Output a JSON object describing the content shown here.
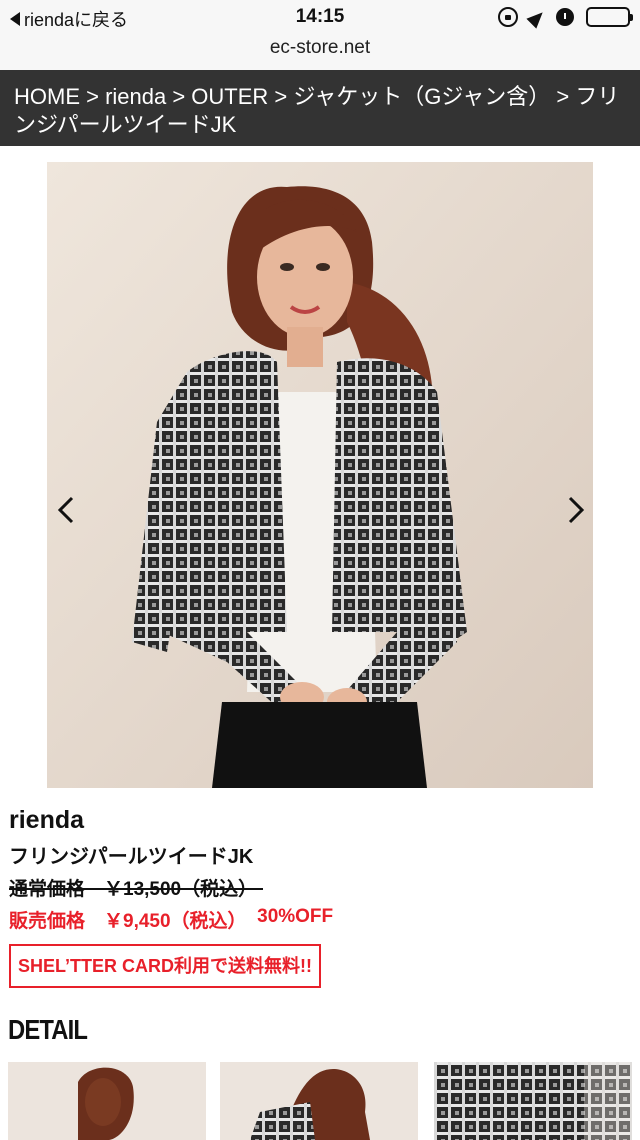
{
  "status_bar": {
    "back_label": "riendaに戻る",
    "time": "14:15",
    "battery_level": 0.85
  },
  "browser": {
    "url": "ec-store.net"
  },
  "breadcrumb": {
    "text": "HOME > rienda > OUTER > ジャケット（Gジャン含） > フリンジパールツイードJK"
  },
  "product": {
    "brand": "rienda",
    "name": "フリンジパールツイードJK",
    "regular_price_label": "通常価格　￥13,500（税込）",
    "sale_price_label": "販売価格　￥9,450（税込）",
    "discount": "30%OFF",
    "promo": "SHEL’TTER CARD利用で送料無料!!"
  },
  "detail": {
    "heading": "DETAIL"
  },
  "icons": {
    "prev": "chevron-left-icon",
    "next": "chevron-right-icon",
    "back": "back-triangle-icon"
  },
  "colors": {
    "breadcrumb_bg": "#333333",
    "sale_red": "#e8202a"
  }
}
